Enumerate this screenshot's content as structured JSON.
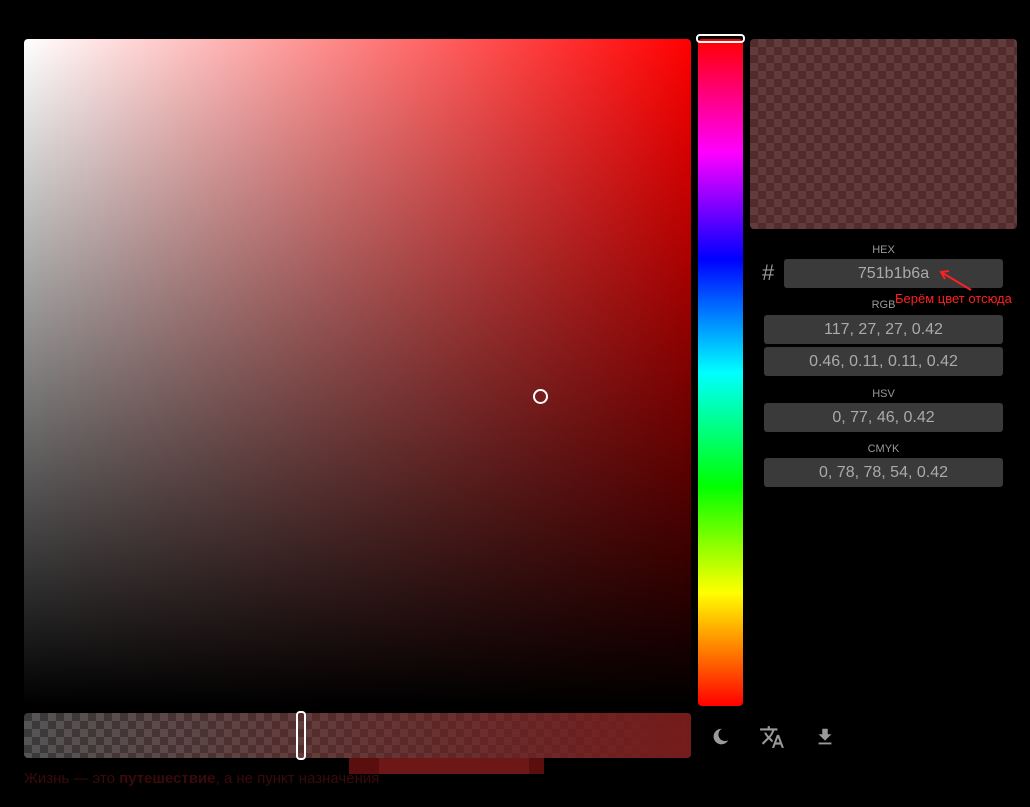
{
  "labels": {
    "hex": "HEX",
    "rgb": "RGB",
    "hsv": "HSV",
    "cmyk": "CMYK",
    "hash": "#"
  },
  "values": {
    "hex": "751b1b6a",
    "rgb": "117, 27, 27, 0.42",
    "rgb_normalized": "0.46, 0.11, 0.11, 0.42",
    "hsv": "0, 77, 46, 0.42",
    "cmyk": "0, 78, 78, 54, 0.42"
  },
  "annotation": "Берём цвет отсюда",
  "quote": {
    "before": "Жизнь — это ",
    "bold": "путешествие",
    "after": ", а не пункт назначения"
  },
  "icons": [
    "moon-icon",
    "translate-icon",
    "download-icon"
  ],
  "colors": {
    "selected": "#751b1b",
    "alpha": 0.42,
    "hue_base": "#ff0000",
    "annotation": "#ff2020"
  }
}
